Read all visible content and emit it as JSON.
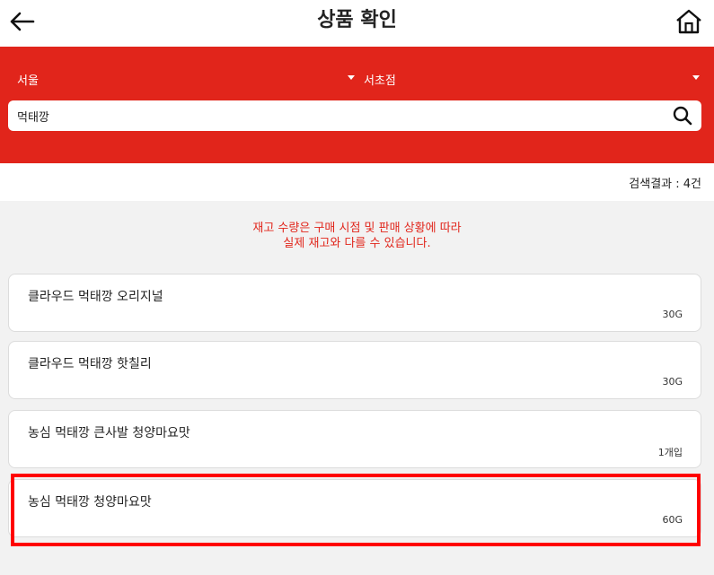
{
  "header": {
    "title": "상품 확인",
    "back_icon": "back-arrow-icon",
    "home_icon": "home-icon"
  },
  "filters": {
    "region": "서울",
    "store": "서초점"
  },
  "search": {
    "value": "먹태깡",
    "icon": "search-icon"
  },
  "results": {
    "count_label": "검색결과 : 4건"
  },
  "notice": {
    "line1": "재고 수량은 구매 시점 및 판매 상황에 따라",
    "line2": "실제 재고와 다를 수 있습니다."
  },
  "products": [
    {
      "name": "클라우드 먹태깡 오리지널",
      "spec": "30G"
    },
    {
      "name": "클라우드 먹태깡 핫칠리",
      "spec": "30G"
    },
    {
      "name": "농심 먹태깡 큰사발 청양마요맛",
      "spec": "1개입"
    },
    {
      "name": "농심 먹태깡 청양마요맛",
      "spec": "60G"
    }
  ],
  "colors": {
    "brand_red": "#e1251b",
    "highlight": "#ff0000"
  }
}
